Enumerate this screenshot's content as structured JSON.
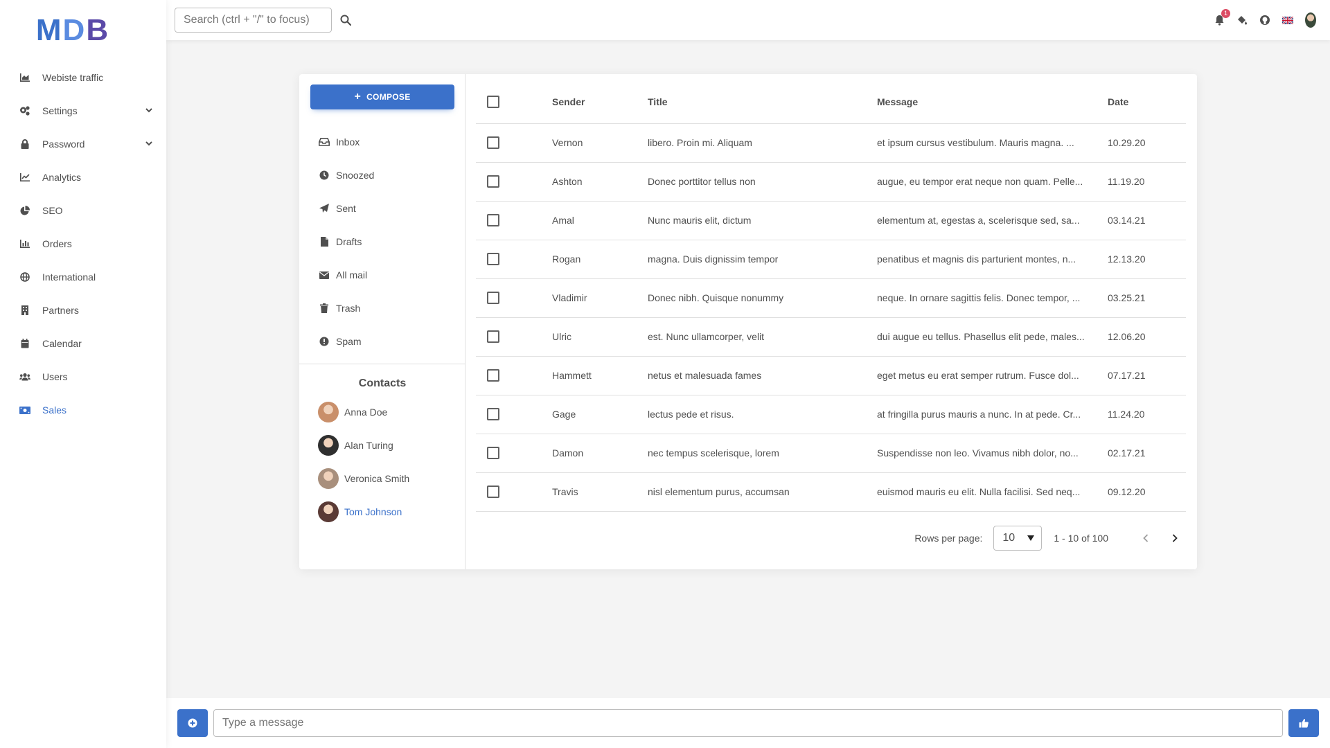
{
  "logo": {
    "m": "M",
    "d": "D",
    "b": "B"
  },
  "sidebar": {
    "items": [
      {
        "label": "Webiste traffic",
        "icon": "chart-area-icon"
      },
      {
        "label": "Settings",
        "icon": "cogs-icon",
        "expandable": true
      },
      {
        "label": "Password",
        "icon": "lock-icon",
        "expandable": true
      },
      {
        "label": "Analytics",
        "icon": "chart-line-icon"
      },
      {
        "label": "SEO",
        "icon": "chart-pie-icon"
      },
      {
        "label": "Orders",
        "icon": "chart-bar-icon"
      },
      {
        "label": "International",
        "icon": "globe-icon"
      },
      {
        "label": "Partners",
        "icon": "building-icon"
      },
      {
        "label": "Calendar",
        "icon": "calendar-icon"
      },
      {
        "label": "Users",
        "icon": "users-icon"
      },
      {
        "label": "Sales",
        "icon": "money-bill-icon",
        "active": true
      }
    ]
  },
  "topbar": {
    "search_placeholder": "Search (ctrl + \"/\" to focus)",
    "notification_count": "1",
    "icons": [
      "bell-icon",
      "paint-bucket-icon",
      "github-icon",
      "uk-flag-icon",
      "avatar"
    ]
  },
  "mail": {
    "compose_label": "COMPOSE",
    "folders": [
      {
        "label": "Inbox",
        "icon": "inbox-icon"
      },
      {
        "label": "Snoozed",
        "icon": "clock-icon"
      },
      {
        "label": "Sent",
        "icon": "paper-plane-icon"
      },
      {
        "label": "Drafts",
        "icon": "file-icon"
      },
      {
        "label": "All mail",
        "icon": "envelope-icon"
      },
      {
        "label": "Trash",
        "icon": "trash-icon"
      },
      {
        "label": "Spam",
        "icon": "exclamation-circle-icon"
      }
    ],
    "contacts_title": "Contacts",
    "contacts": [
      {
        "name": "Anna Doe",
        "color": "#c98f6a"
      },
      {
        "name": "Alan Turing",
        "color": "#2f2f2f"
      },
      {
        "name": "Veronica Smith",
        "color": "#a88f7c"
      },
      {
        "name": "Tom Johnson",
        "color": "#5a3a35",
        "active": true
      }
    ]
  },
  "table": {
    "headers": [
      "Sender",
      "Title",
      "Message",
      "Date"
    ],
    "rows": [
      {
        "sender": "Vernon",
        "title": "libero. Proin mi. Aliquam",
        "message": "et ipsum cursus vestibulum. Mauris magna. ...",
        "date": "10.29.20"
      },
      {
        "sender": "Ashton",
        "title": "Donec porttitor tellus non",
        "message": "augue, eu tempor erat neque non quam. Pelle...",
        "date": "11.19.20"
      },
      {
        "sender": "Amal",
        "title": "Nunc mauris elit, dictum",
        "message": "elementum at, egestas a, scelerisque sed, sa...",
        "date": "03.14.21"
      },
      {
        "sender": "Rogan",
        "title": "magna. Duis dignissim tempor",
        "message": "penatibus et magnis dis parturient montes, n...",
        "date": "12.13.20"
      },
      {
        "sender": "Vladimir",
        "title": "Donec nibh. Quisque nonummy",
        "message": "neque. In ornare sagittis felis. Donec tempor, ...",
        "date": "03.25.21"
      },
      {
        "sender": "Ulric",
        "title": "est. Nunc ullamcorper, velit",
        "message": "dui augue eu tellus. Phasellus elit pede, males...",
        "date": "12.06.20"
      },
      {
        "sender": "Hammett",
        "title": "netus et malesuada fames",
        "message": "eget metus eu erat semper rutrum. Fusce dol...",
        "date": "07.17.21"
      },
      {
        "sender": "Gage",
        "title": "lectus pede et risus.",
        "message": "at fringilla purus mauris a nunc. In at pede. Cr...",
        "date": "11.24.20"
      },
      {
        "sender": "Damon",
        "title": "nec tempus scelerisque, lorem",
        "message": "Suspendisse non leo. Vivamus nibh dolor, no...",
        "date": "02.17.21"
      },
      {
        "sender": "Travis",
        "title": "nisl elementum purus, accumsan",
        "message": "euismod mauris eu elit. Nulla facilisi. Sed neq...",
        "date": "09.12.20"
      }
    ]
  },
  "pagination": {
    "rows_per_page_label": "Rows per page:",
    "rows_per_page_value": "10",
    "range_text": "1 - 10 of 100"
  },
  "bottombar": {
    "message_placeholder": "Type a message"
  },
  "colors": {
    "primary": "#3b71ca",
    "badge": "#dc4c64"
  }
}
